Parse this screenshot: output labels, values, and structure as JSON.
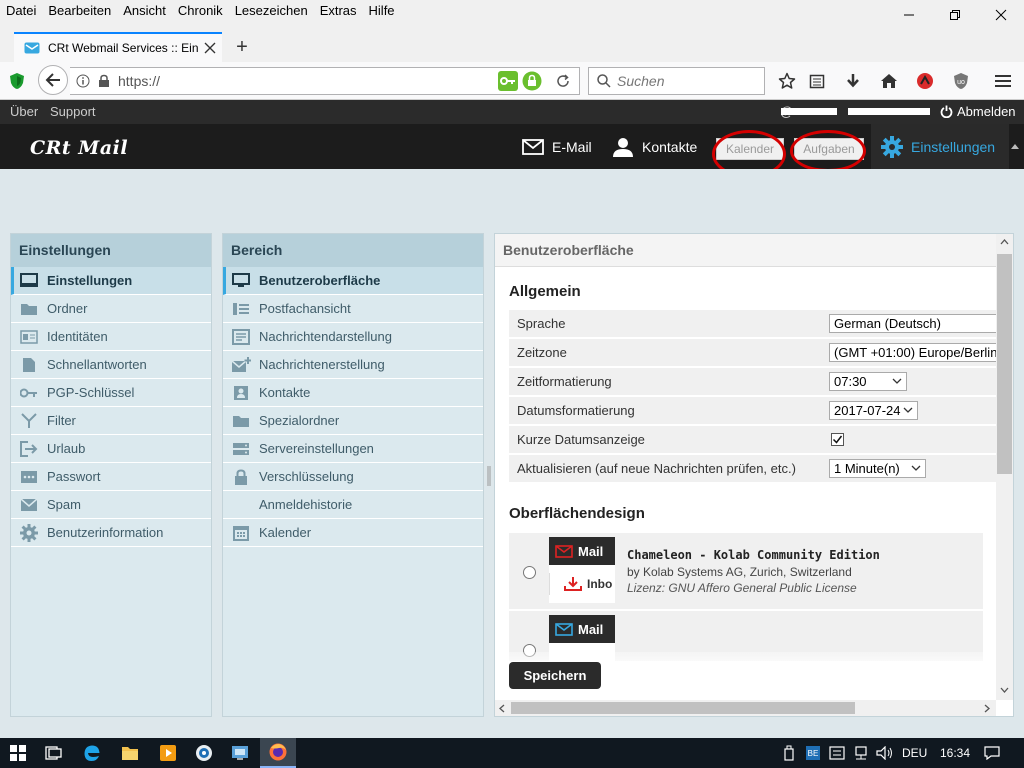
{
  "browser": {
    "menu": [
      "Datei",
      "Bearbeiten",
      "Ansicht",
      "Chronik",
      "Lesezeichen",
      "Extras",
      "Hilfe"
    ],
    "tab_title": "CRt Webmail Services :: Einst",
    "url": "https://",
    "search_placeholder": "Suchen"
  },
  "app": {
    "top_links": [
      "Über",
      "Support"
    ],
    "user": "                    @                ",
    "logout": "Abmelden",
    "logo": "CRt Mail",
    "nav": {
      "mail": "E-Mail",
      "contacts": "Kontakte",
      "calendar": "Kalender",
      "tasks": "Aufgaben",
      "settings": "Einstellungen"
    }
  },
  "left_panel": {
    "title": "Einstellungen",
    "items": [
      {
        "label": "Einstellungen",
        "icon": "monitor-icon",
        "selected": true
      },
      {
        "label": "Ordner",
        "icon": "folder-icon"
      },
      {
        "label": "Identitäten",
        "icon": "id-card-icon"
      },
      {
        "label": "Schnellantworten",
        "icon": "document-icon"
      },
      {
        "label": "PGP-Schlüssel",
        "icon": "key-icon"
      },
      {
        "label": "Filter",
        "icon": "filter-icon"
      },
      {
        "label": "Urlaub",
        "icon": "exit-icon"
      },
      {
        "label": "Passwort",
        "icon": "password-icon"
      },
      {
        "label": "Spam",
        "icon": "spam-icon"
      },
      {
        "label": "Benutzerinformation",
        "icon": "gear-icon"
      }
    ]
  },
  "middle_panel": {
    "title": "Bereich",
    "items": [
      {
        "label": "Benutzeroberfläche",
        "icon": "monitor-icon",
        "selected": true
      },
      {
        "label": "Postfachansicht",
        "icon": "list-icon"
      },
      {
        "label": "Nachrichtendarstellung",
        "icon": "message-icon"
      },
      {
        "label": "Nachrichtenerstellung",
        "icon": "compose-icon"
      },
      {
        "label": "Kontakte",
        "icon": "contact-card-icon"
      },
      {
        "label": "Spezialordner",
        "icon": "folder-icon"
      },
      {
        "label": "Servereinstellungen",
        "icon": "server-icon"
      },
      {
        "label": "Verschlüsselung",
        "icon": "lock-icon"
      },
      {
        "label": "Anmeldehistorie",
        "icon": ""
      },
      {
        "label": "Kalender",
        "icon": "calendar-icon"
      }
    ]
  },
  "main": {
    "title": "Benutzeroberfläche",
    "general_title": "Allgemein",
    "fields": [
      {
        "label": "Sprache",
        "value": "German (Deutsch)"
      },
      {
        "label": "Zeitzone",
        "value": "(GMT +01:00) Europe/Berlin"
      },
      {
        "label": "Zeitformatierung",
        "value": "07:30"
      },
      {
        "label": "Datumsformatierung",
        "value": "2017-07-24"
      },
      {
        "label": "Kurze Datumsanzeige",
        "checked": true
      },
      {
        "label": "Aktualisieren (auf neue Nachrichten prüfen, etc.)",
        "value": "1 Minute(n)"
      }
    ],
    "design_title": "Oberflächendesign",
    "skins": [
      {
        "thumb_title": "Mail",
        "thumb_sub": "Inbo",
        "name": "Chameleon - Kolab Community Edition",
        "by": "by Kolab Systems AG, Zurich, Switzerland",
        "license": "Lizenz: GNU Affero General Public License"
      },
      {
        "thumb_title": "Mail"
      }
    ],
    "save": "Speichern"
  },
  "taskbar": {
    "lang": "DEU",
    "time": "16:34"
  }
}
